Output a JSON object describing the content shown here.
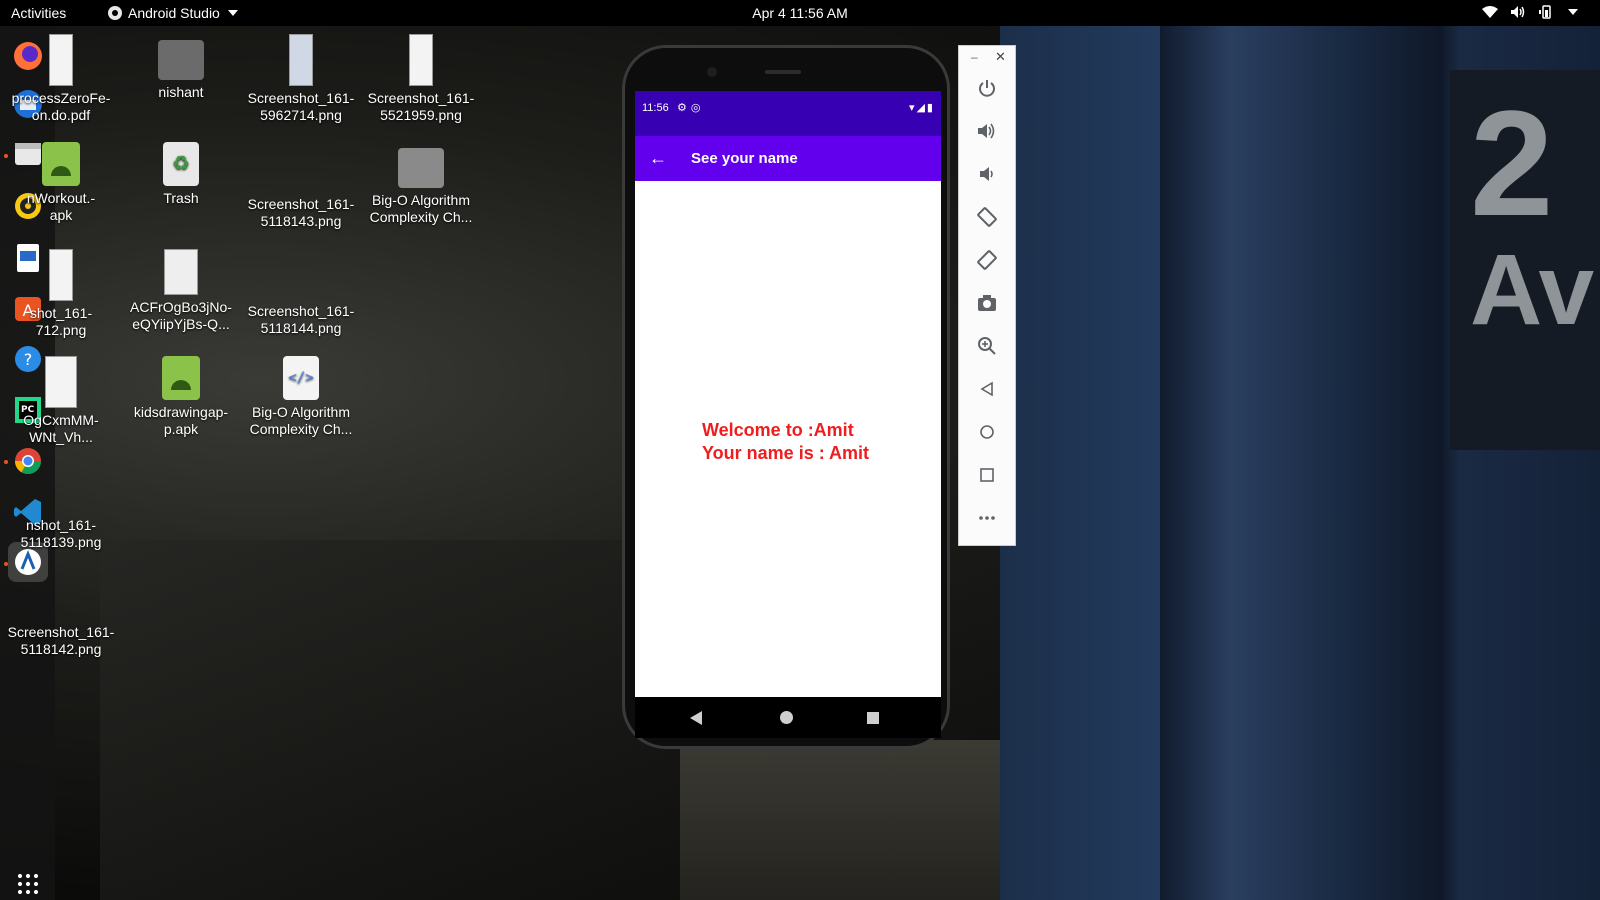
{
  "topbar": {
    "activities": "Activities",
    "app_name": "Android Studio",
    "clock": "Apr 4  11:56 AM",
    "tray_icons": [
      "wifi-icon",
      "volume-icon",
      "battery-icon",
      "chevron-down-icon"
    ]
  },
  "dock": {
    "apps": [
      "firefox-icon",
      "thunderbird-icon",
      "files-icon",
      "rhythmbox-icon",
      "libreoffice-writer-icon",
      "ubuntu-software-icon",
      "help-icon",
      "pycharm-icon",
      "chrome-icon",
      "vscode-icon",
      "android-studio-icon"
    ],
    "show_apps": "show-applications-icon"
  },
  "desktop": {
    "icons": [
      {
        "label": "processZeroFe-\non.do.pdf"
      },
      {
        "label": "nishant"
      },
      {
        "label": "Screenshot_161-\n5962714.png"
      },
      {
        "label": "Screenshot_161-\n5521959.png"
      },
      {
        "label": "nWorkout.-\napk"
      },
      {
        "label": "Trash"
      },
      {
        "label": "Screenshot_161-\n5118143.png"
      },
      {
        "label": "Big-O Algorithm\nComplexity Ch..."
      },
      {
        "label": "shot_161-\n712.png"
      },
      {
        "label": "ACFrOgBo3jNo-\neQYiipYjBs-Q..."
      },
      {
        "label": "Screenshot_161-\n5118144.png"
      },
      {
        "label": "OgCxmMM-\nWNt_Vh..."
      },
      {
        "label": "kidsdrawingap-\np.apk"
      },
      {
        "label": "Big-O Algorithm\nComplexity Ch..."
      },
      {
        "label": "nshot_161-\n5118139.png"
      },
      {
        "label": "Screenshot_161-\n5118142.png"
      }
    ]
  },
  "phone": {
    "status_time": "11:56",
    "app_title": "See your name",
    "welcome_line": "Welcome to :Amit",
    "name_line": "Your name is : Amit",
    "accent_color": "#6200ee",
    "status_color": "#3700b3",
    "text_color": "#ef1d1d"
  },
  "emulator_toolbar": {
    "buttons": [
      "power-icon",
      "volume-up-icon",
      "volume-down-icon",
      "rotate-left-icon",
      "rotate-right-icon",
      "camera-icon",
      "zoom-icon",
      "back-icon",
      "home-icon",
      "overview-icon",
      "more-icon"
    ]
  },
  "wallpaper": {
    "sign_number": "2",
    "sign_text": "Av"
  }
}
